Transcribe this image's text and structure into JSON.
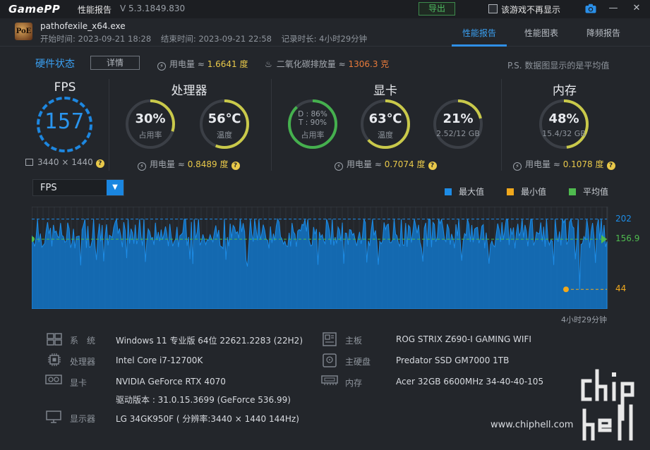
{
  "titlebar": {
    "logo": "GamePP",
    "title": "性能报告",
    "version": "V 5.3.1849.830",
    "export_label": "导出",
    "checkbox_label": "该游戏不再显示",
    "icons": {
      "camera": "camera-icon",
      "minimize": "minimize-icon",
      "close": "close-icon"
    }
  },
  "app": {
    "icon_text": "PoE",
    "exe": "pathofexile_x64.exe",
    "start_time": "开始时间: 2023-09-21 18:28",
    "end_time": "结束时间: 2023-09-21 22:58",
    "duration": "记录时长: 4小时29分钟"
  },
  "tabs": [
    "性能报告",
    "性能图表",
    "降频报告"
  ],
  "active_tab": 0,
  "hardware": {
    "title": "硬件状态",
    "detail_label": "详情",
    "power_label": "用电量 ≈",
    "power_value": "1.6641 度",
    "co2_label": "二氧化碳排放量 ≈",
    "co2_value": "1306.3 克",
    "note": "P.S. 数据图显示的是平均值"
  },
  "fps": {
    "title": "FPS",
    "value": "157",
    "resolution": "3440 × 1440"
  },
  "cpu": {
    "title": "处理器",
    "usage": {
      "value": "30%",
      "label": "占用率",
      "fraction": 0.3
    },
    "temp": {
      "value": "56℃",
      "label": "温度",
      "fraction": 0.56
    },
    "power_label": "用电量 ≈",
    "power_value": "0.8489 度"
  },
  "gpu": {
    "title": "显卡",
    "usage": {
      "line1": "D : 86%",
      "line2": "T : 90%",
      "label": "占用率",
      "fraction": 0.88
    },
    "temp": {
      "value": "63℃",
      "label": "温度",
      "fraction": 0.63
    },
    "vram": {
      "value": "21%",
      "label": "2.52/12 GB",
      "fraction": 0.21
    },
    "power_label": "用电量 ≈",
    "power_value": "0.7074 度"
  },
  "memory": {
    "title": "内存",
    "usage": {
      "value": "48%",
      "label": "15.4/32 GB",
      "fraction": 0.48
    },
    "power_label": "用电量 ≈",
    "power_value": "0.1078 度"
  },
  "graph": {
    "selector": "FPS",
    "legend": [
      {
        "label": "最大值",
        "color": "#1d8ce6"
      },
      {
        "label": "最小值",
        "color": "#f0a81d"
      },
      {
        "label": "平均值",
        "color": "#4fbb4f"
      }
    ],
    "duration_label": "4小时29分钟"
  },
  "chart_data": {
    "type": "area",
    "series_name": "FPS",
    "max": 202,
    "avg": 156.9,
    "min": 44,
    "max_label": "202",
    "avg_label": "156.9",
    "min_label": "44",
    "ylim": [
      0,
      230
    ],
    "colors": {
      "max": "#1d8ce6",
      "min": "#f0a81d",
      "avg": "#4fbb4f"
    }
  },
  "system": {
    "left": [
      {
        "icon": "windows-icon",
        "key": "系　统",
        "value": "Windows 11 专业版 64位 22621.2283 (22H2)"
      },
      {
        "icon": "cpu-icon",
        "key": "处理器",
        "value": "Intel Core i7-12700K"
      },
      {
        "icon": "gpu-icon",
        "key": "显卡",
        "value": "NVIDIA GeForce RTX 4070"
      },
      {
        "icon": "",
        "key": "",
        "value": "驱动版本 : 31.0.15.3699 (GeForce 536.99)"
      },
      {
        "icon": "monitor-icon",
        "key": "显示器",
        "value": "LG 34GK950F ( 分辨率:3440 × 1440 144Hz)"
      }
    ],
    "right": [
      {
        "icon": "motherboard-icon",
        "key": "主板",
        "value": "ROG STRIX Z690-I GAMING WIFI"
      },
      {
        "icon": "disk-icon",
        "key": "主硬盘",
        "value": "Predator SSD GM7000 1TB"
      },
      {
        "icon": "memory-icon",
        "key": "内存",
        "value": "Acer 32GB 6600MHz 34-40-40-105"
      }
    ]
  },
  "watermark": {
    "url": "www.chiphell.com",
    "brand": "chip hell"
  }
}
